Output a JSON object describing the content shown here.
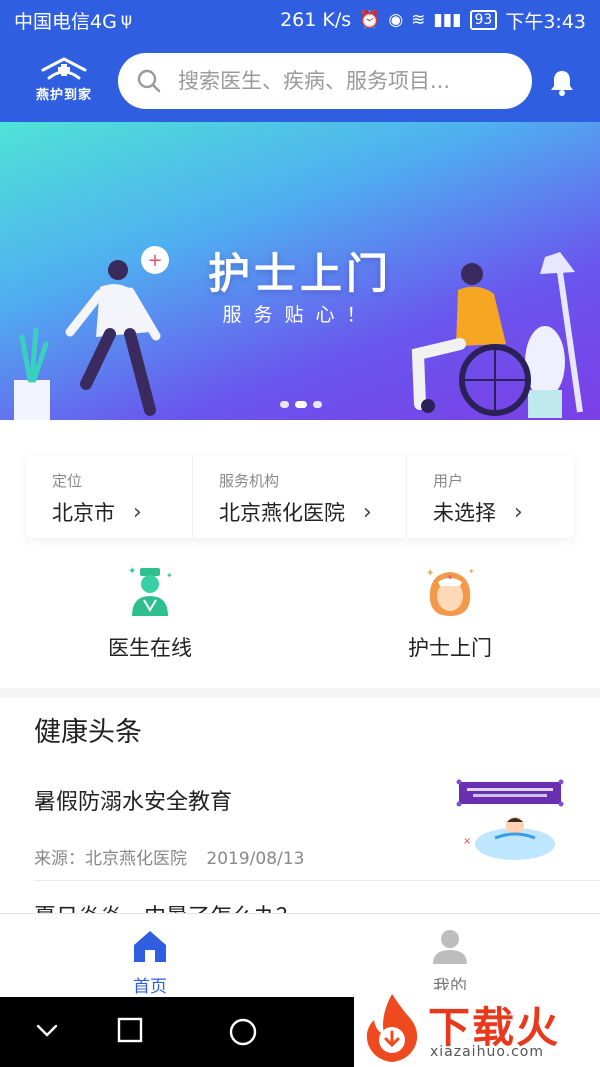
{
  "statusbar": {
    "carrier": "中国电信4G",
    "speed": "261 K/s",
    "battery": "93",
    "time": "下午3:43"
  },
  "header": {
    "logo_text": "燕护到家",
    "search_placeholder": "搜索医生、疾病、服务项目...",
    "icons": [
      "search-icon",
      "bell-icon"
    ],
    "brand_color": "#2f5fe0"
  },
  "banner": {
    "title": "护士上门",
    "subtitle": "服务贴心！",
    "slides": 3,
    "active_slide": 2
  },
  "location": {
    "items": [
      {
        "label": "定位",
        "value": "北京市"
      },
      {
        "label": "服务机构",
        "value": "北京燕化医院"
      },
      {
        "label": "用户",
        "value": "未选择"
      }
    ]
  },
  "services": [
    {
      "label": "医生在线",
      "icon": "doctor-icon"
    },
    {
      "label": "护士上门",
      "icon": "nurse-icon"
    }
  ],
  "news": {
    "section_title": "健康头条",
    "items": [
      {
        "headline": "暑假防溺水安全教育",
        "source": "来源：北京燕化医院",
        "date": "2019/08/13"
      },
      {
        "headline": "夏日炎炎，中暑了怎么办？"
      }
    ]
  },
  "tabbar": {
    "tabs": [
      {
        "label": "首页",
        "icon": "home-icon",
        "active": true
      },
      {
        "label": "我的",
        "icon": "user-icon",
        "active": false
      }
    ]
  },
  "watermark": {
    "brand": "下载火",
    "url": "xiazaihuo.com"
  }
}
